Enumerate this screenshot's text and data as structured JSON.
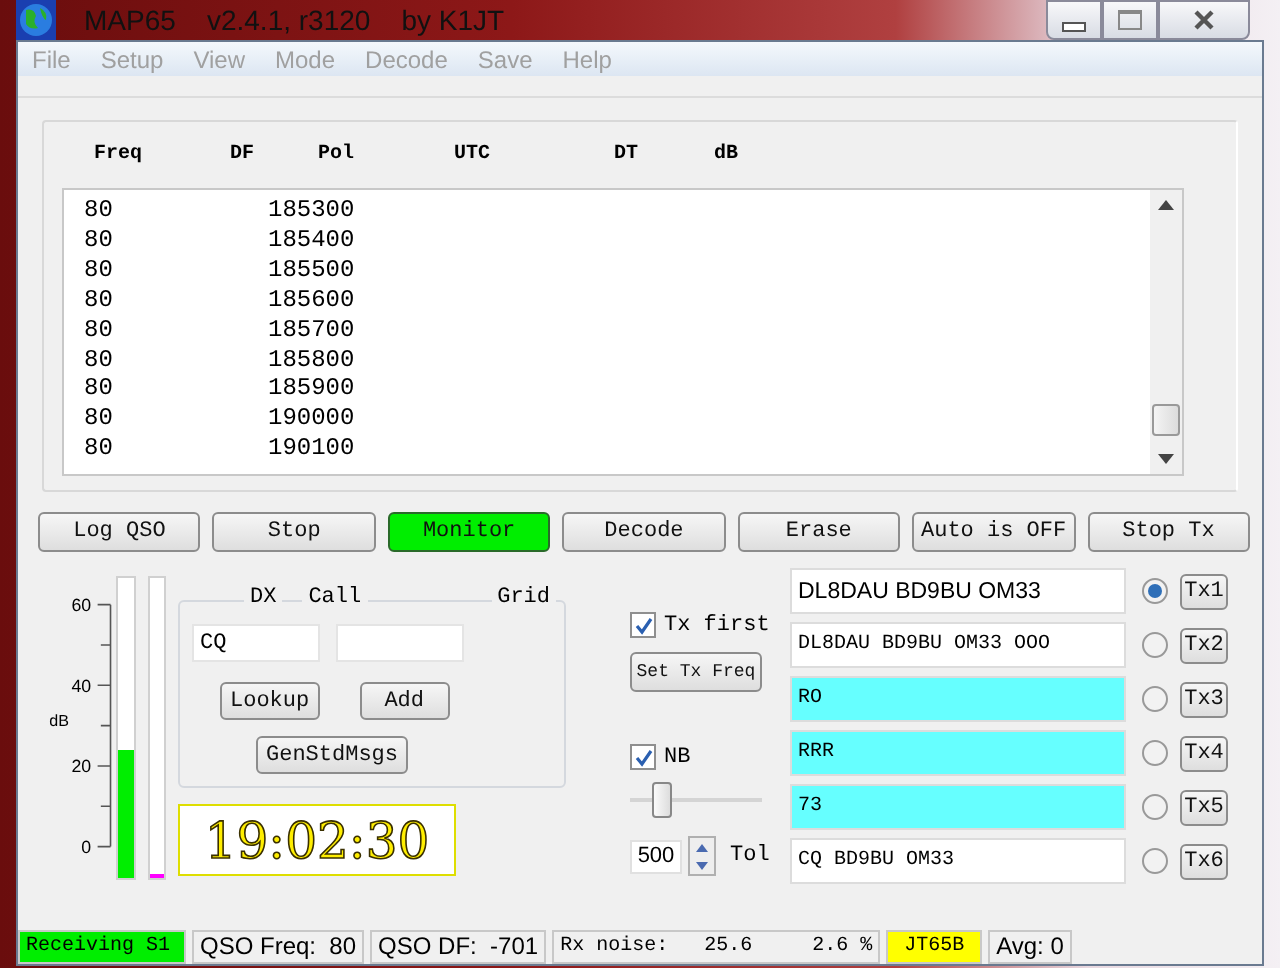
{
  "window": {
    "title": "MAP65    v2.4.1, r3120    by K1JT"
  },
  "menu": [
    {
      "label": "File",
      "disabled": true
    },
    {
      "label": "Setup",
      "disabled": true
    },
    {
      "label": "View",
      "disabled": true
    },
    {
      "label": "Mode",
      "disabled": true
    },
    {
      "label": "Decode",
      "disabled": true
    },
    {
      "label": "Save",
      "disabled": true
    },
    {
      "label": "Help",
      "disabled": true
    }
  ],
  "table": {
    "columns": [
      "Freq",
      "DF",
      "Pol",
      "UTC",
      "DT",
      "dB"
    ],
    "rows": [
      {
        "freq": "80",
        "column_2": "185300"
      },
      {
        "freq": "80",
        "column_2": "185400"
      },
      {
        "freq": "80",
        "column_2": "185500"
      },
      {
        "freq": "80",
        "column_2": "185600"
      },
      {
        "freq": "80",
        "column_2": "185700"
      },
      {
        "freq": "80",
        "column_2": "185800"
      },
      {
        "freq": "80",
        "column_2": "185900"
      },
      {
        "freq": "80",
        "column_2": "190000"
      },
      {
        "freq": "80",
        "column_2": "190100"
      }
    ]
  },
  "buttons": [
    {
      "label": "Log QSO",
      "on": false
    },
    {
      "label": "Stop",
      "on": false
    },
    {
      "label": "Monitor",
      "on": true
    },
    {
      "label": "Decode",
      "on": false
    },
    {
      "label": "Erase",
      "on": false
    },
    {
      "label": "Auto is OFF",
      "on": false
    },
    {
      "label": "Stop Tx",
      "on": false
    }
  ],
  "meter": {
    "scale": [
      "60",
      "40",
      "20",
      "0"
    ],
    "unit": "dB",
    "bars": [
      {
        "level": 0.43,
        "color": "#00ee00"
      },
      {
        "level": 0.01,
        "color": "#ff00ff"
      }
    ]
  },
  "dx": {
    "label_dx": "DX",
    "label_call": "Call",
    "label_grid": "Grid",
    "call": "CQ",
    "buttons": [
      "Lookup",
      "Add",
      "GenStdMsgs"
    ]
  },
  "clock": "19:02:30",
  "tx_first": {
    "label": "Tx first",
    "checked": true
  },
  "set_tx_freq": "Set Tx Freq",
  "nb": {
    "label": "NB",
    "checked": true,
    "level": 0.24
  },
  "tol": {
    "value": "500",
    "label": "Tol"
  },
  "messages": [
    {
      "text": "DL8DAU BD9BU OM33",
      "highlighted": false,
      "selected": true,
      "button": "Tx1"
    },
    {
      "text": "DL8DAU BD9BU OM33 OOO",
      "highlighted": false,
      "selected": false,
      "button": "Tx2"
    },
    {
      "text": "RO",
      "highlighted": true,
      "selected": false,
      "button": "Tx3"
    },
    {
      "text": "RRR",
      "highlighted": true,
      "selected": false,
      "button": "Tx4"
    },
    {
      "text": "73",
      "highlighted": true,
      "selected": false,
      "button": "Tx5"
    },
    {
      "text": "CQ BD9BU OM33",
      "highlighted": false,
      "selected": false,
      "button": "Tx6"
    }
  ],
  "status_bar": [
    {
      "text": "Receiving S1",
      "color": "#00ee00"
    },
    {
      "text": "QSO Freq:  80"
    },
    {
      "text": "QSO DF:  -701"
    },
    {
      "text": "Rx noise:   25.6     2.6 %"
    },
    {
      "text": "JT65B",
      "color": "#ffff00"
    },
    {
      "text": "Avg: 0"
    }
  ]
}
